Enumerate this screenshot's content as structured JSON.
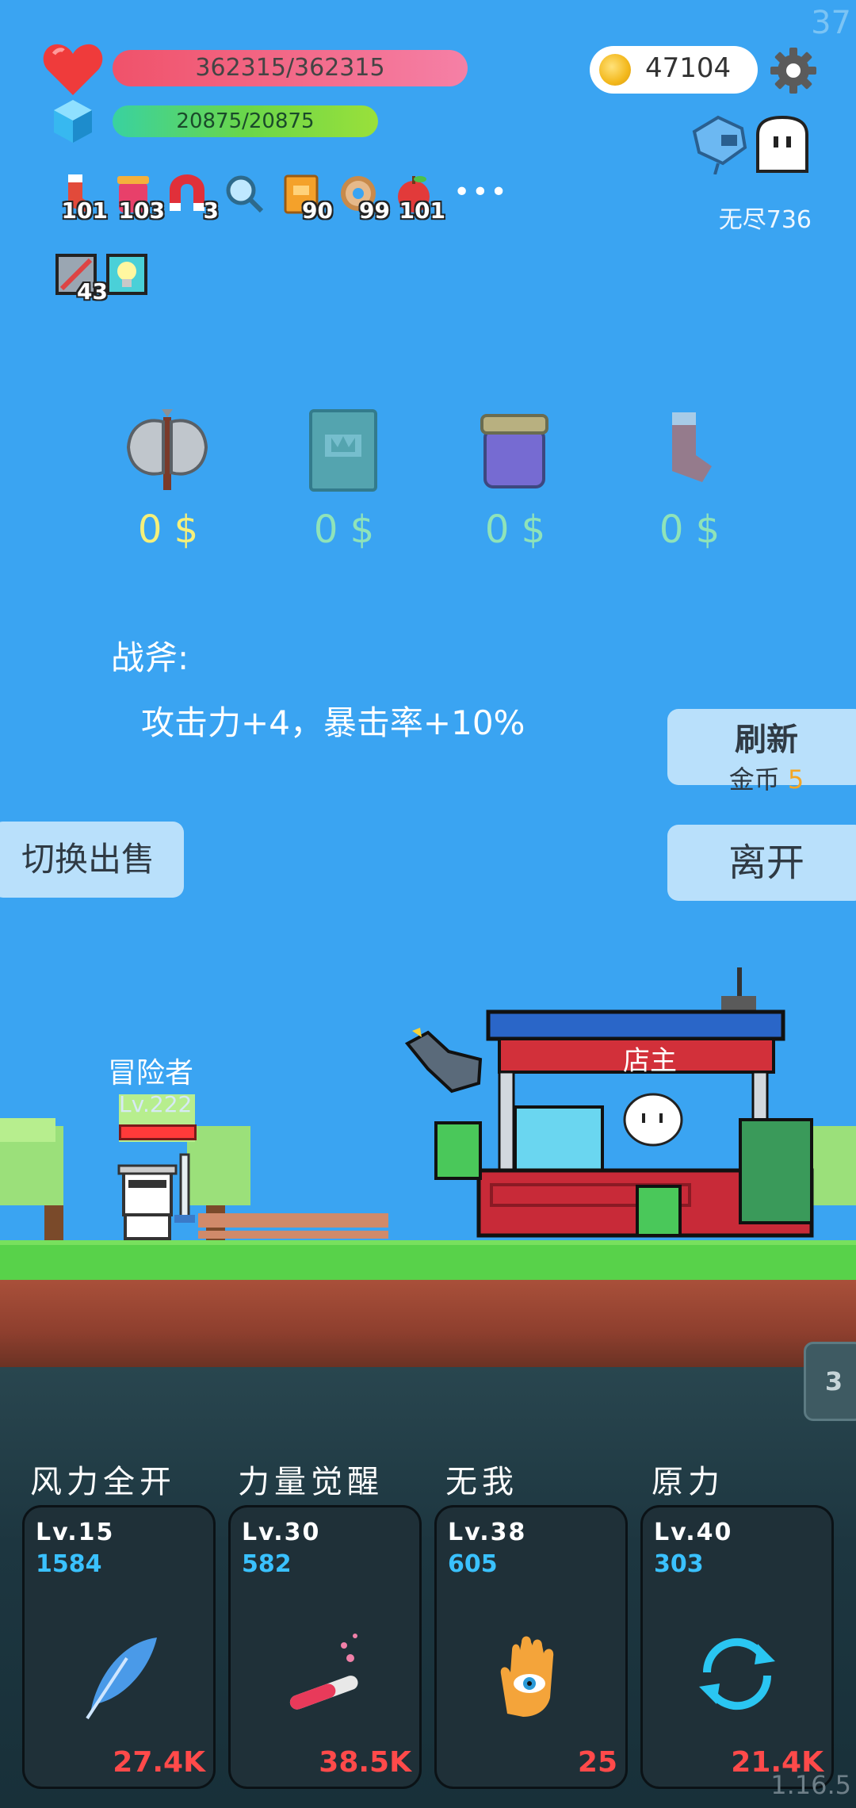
{
  "fps_counter": "37",
  "version": "1.16.5",
  "hp": {
    "text": "362315/362315"
  },
  "mp": {
    "text": "20875/20875"
  },
  "gold": {
    "amount": "47104"
  },
  "endless_label": "无尽736",
  "buffs": [
    {
      "icon": "sock-icon",
      "count": "101"
    },
    {
      "icon": "jam-jar-icon",
      "count": "103"
    },
    {
      "icon": "magnet-icon",
      "count": "3"
    },
    {
      "icon": "magnifier-icon",
      "count": ""
    },
    {
      "icon": "book-icon",
      "count": "90"
    },
    {
      "icon": "donut-icon",
      "count": "99"
    },
    {
      "icon": "apple-icon",
      "count": "101"
    }
  ],
  "buffs_row2": [
    {
      "icon": "scroll-icon",
      "count": "43"
    },
    {
      "icon": "lightbulb-icon",
      "count": ""
    }
  ],
  "shop_items": [
    {
      "icon": "battle-axe-icon",
      "price": "0 $",
      "selected": true
    },
    {
      "icon": "book-icon",
      "price": "0 $",
      "selected": false
    },
    {
      "icon": "jam-jar-icon",
      "price": "0 $",
      "selected": false
    },
    {
      "icon": "sock-icon",
      "price": "0 $",
      "selected": false
    }
  ],
  "description": {
    "title": "战斧:",
    "text": "攻击力+4，暴击率+10%"
  },
  "refresh_button": {
    "title": "刷新",
    "cost_label": "金币",
    "cost_value": "5"
  },
  "leave_button": "离开",
  "switch_button": "切换出售",
  "scene": {
    "adventurer_label": "冒险者",
    "adventurer_level": "Lv.222",
    "shopkeeper_label": "店主",
    "side_tab_number": "3"
  },
  "skills": [
    {
      "name": "风力全开",
      "level": "Lv.15",
      "value": "1584",
      "cost": "27.4K",
      "icon": "feather-icon"
    },
    {
      "name": "力量觉醒",
      "level": "Lv.30",
      "value": "582",
      "cost": "38.5K",
      "icon": "potion-icon"
    },
    {
      "name": "无我",
      "level": "Lv.38",
      "value": "605",
      "cost": "25",
      "icon": "eye-hand-icon"
    },
    {
      "name": "原力",
      "level": "Lv.40",
      "value": "303",
      "cost": "21.4K",
      "icon": "refresh-cycle-icon"
    }
  ],
  "colors": {
    "sky": "#3aa4f2",
    "hp_bar": "#f0526a",
    "mp_bar": "#6ad64a",
    "price_active": "#f5f07a",
    "price_inactive": "#8fe3b9",
    "skill_value": "#3ac1ff",
    "skill_cost": "#ff4a4a"
  }
}
